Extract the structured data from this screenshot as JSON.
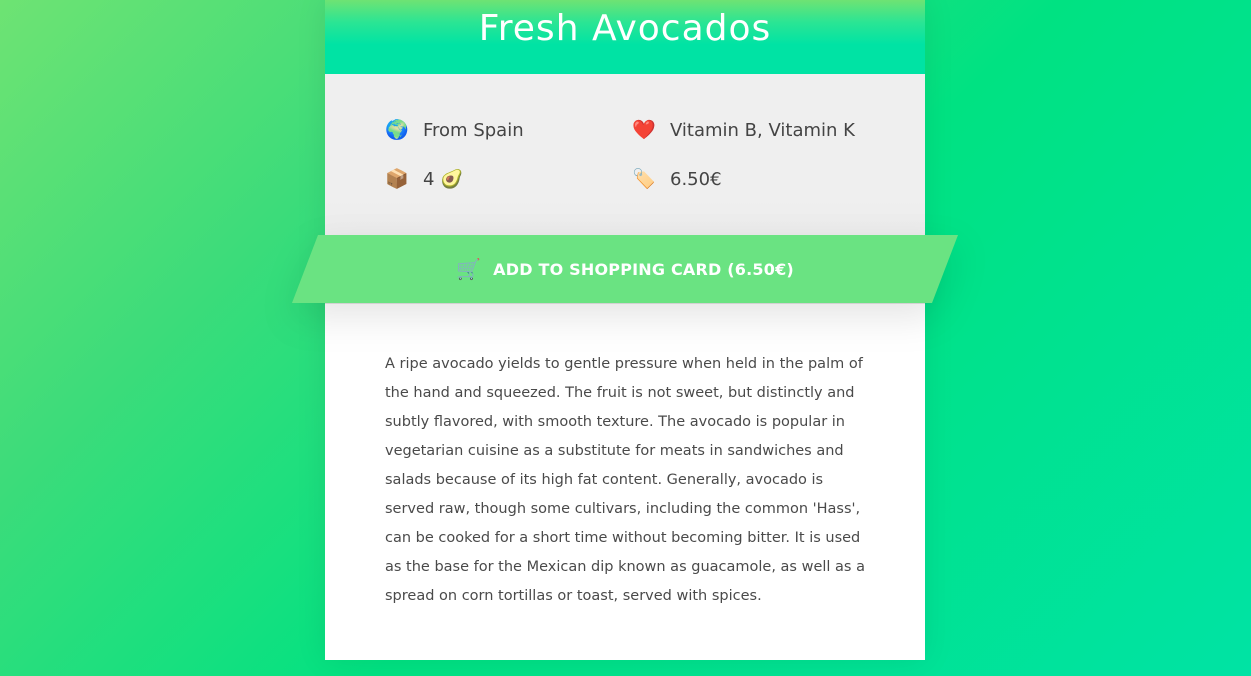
{
  "product": {
    "title": "Fresh Avocados",
    "origin": {
      "icon": "globe-icon",
      "glyph": "🌍",
      "text": "From Spain"
    },
    "vitamins": {
      "icon": "heart-icon",
      "glyph": "❤️",
      "text": "Vitamin B, Vitamin K"
    },
    "quantity": {
      "icon": "package-icon",
      "glyph": "📦",
      "text": "4",
      "suffix_glyph": "🥑"
    },
    "price": {
      "icon": "price-tag-icon",
      "glyph": "🏷️",
      "text": "6.50€"
    }
  },
  "cta": {
    "icon": "shopping-cart-icon",
    "glyph": "🛒",
    "label": "ADD TO SHOPPING CARD (6.50€)"
  },
  "description": "A ripe avocado yields to gentle pressure when held in the palm of the hand and squeezed. The fruit is not sweet, but distinctly and subtly flavored, with smooth texture. The avocado is popular in vegetarian cuisine as a substitute for meats in sandwiches and salads because of its high fat content. Generally, avocado is served raw, though some cultivars, including the common 'Hass', can be cooked for a short time without becoming bitter. It is used as the base for the Mexican dip known as guacamole, as well as a spread on corn tortillas or toast, served with spices.",
  "colors": {
    "accent": "#6ae382",
    "header_top": "#6ee373",
    "header_bottom": "#00e3a4",
    "text": "#444444"
  }
}
